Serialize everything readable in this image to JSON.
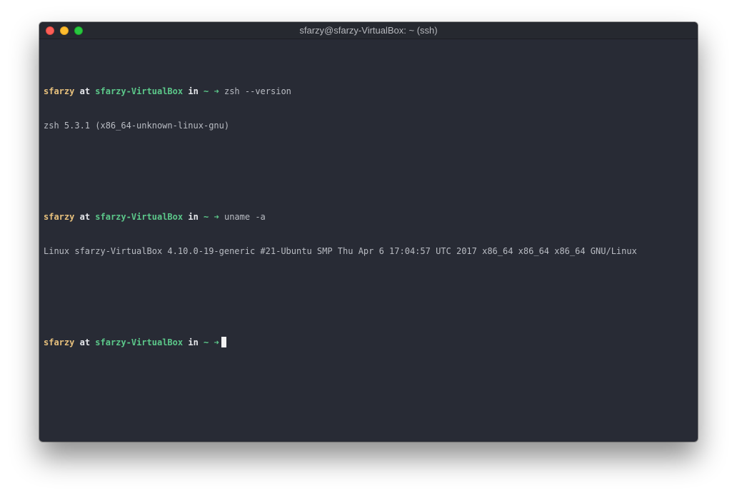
{
  "window": {
    "title": "sfarzy@sfarzy-VirtualBox: ~ (ssh)",
    "buttons": {
      "close": "close-button",
      "minimize": "minimize-button",
      "zoom": "zoom-button"
    }
  },
  "prompt": {
    "user": "sfarzy",
    "at": "at",
    "host": "sfarzy-VirtualBox",
    "in": "in",
    "dir": "~",
    "arrow": "➜"
  },
  "session": {
    "commands": [
      {
        "command": "zsh --version",
        "output": "zsh 5.3.1 (x86_64-unknown-linux-gnu)"
      },
      {
        "command": "uname -a",
        "output": "Linux sfarzy-VirtualBox 4.10.0-19-generic #21-Ubuntu SMP Thu Apr 6 17:04:57 UTC 2017 x86_64 x86_64 x86_64 GNU/Linux"
      }
    ],
    "current_input": ""
  },
  "colors": {
    "background": "#282b35",
    "user": "#e8c17d",
    "host": "#5cc88a",
    "text": "#b9bcc3",
    "close": "#fc5f57",
    "minimize": "#fdbc2e",
    "zoom": "#28c840"
  }
}
